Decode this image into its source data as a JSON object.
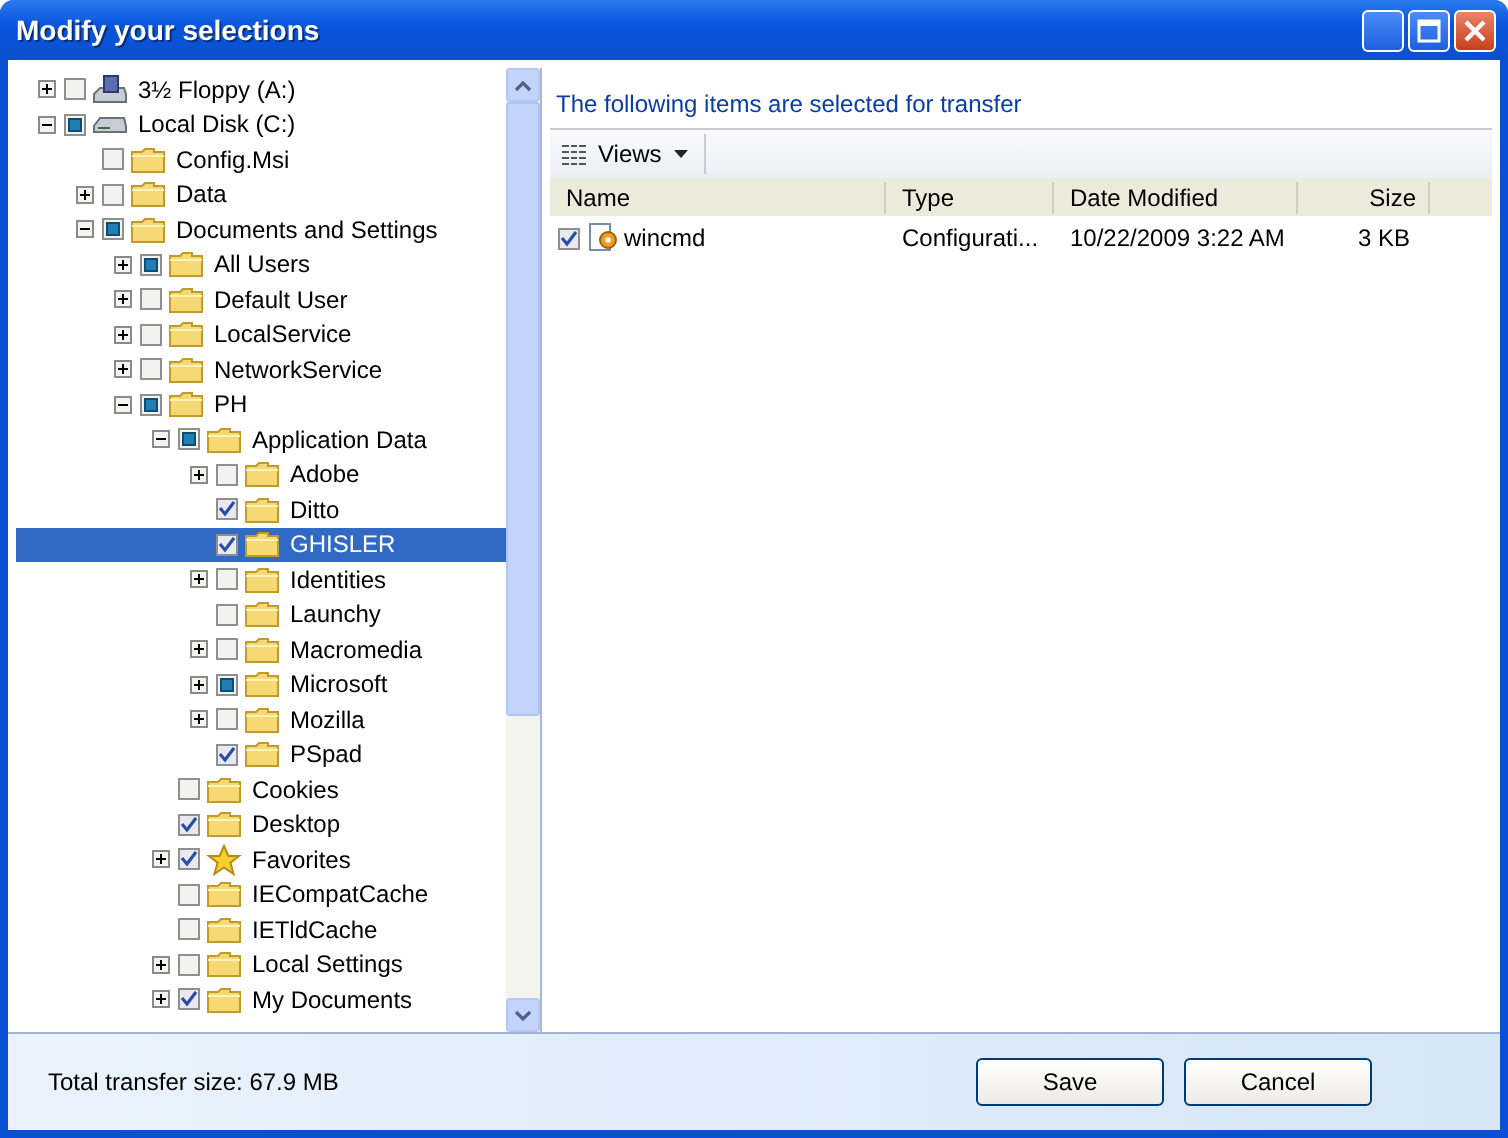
{
  "window": {
    "title": "Modify your selections"
  },
  "tree": [
    {
      "label": "3½ Floppy (A:)",
      "kind": "floppy",
      "checked": false,
      "partial": false,
      "expanded": false,
      "selected": false
    },
    {
      "label": "Local Disk (C:)",
      "kind": "drive",
      "checked": false,
      "partial": true,
      "expanded": true,
      "selected": false,
      "children": [
        {
          "label": "Config.Msi",
          "kind": "folder",
          "checked": false,
          "partial": false,
          "selected": false
        },
        {
          "label": "Data",
          "kind": "folder",
          "checked": false,
          "partial": false,
          "expanded": false,
          "selected": false
        },
        {
          "label": "Documents and Settings",
          "kind": "folder",
          "checked": false,
          "partial": true,
          "expanded": true,
          "selected": false,
          "children": [
            {
              "label": "All Users",
              "kind": "folder",
              "checked": false,
              "partial": true,
              "expanded": false,
              "selected": false
            },
            {
              "label": "Default User",
              "kind": "folder",
              "checked": false,
              "partial": false,
              "expanded": false,
              "selected": false
            },
            {
              "label": "LocalService",
              "kind": "folder",
              "checked": false,
              "partial": false,
              "expanded": false,
              "selected": false
            },
            {
              "label": "NetworkService",
              "kind": "folder",
              "checked": false,
              "partial": false,
              "expanded": false,
              "selected": false
            },
            {
              "label": "PH",
              "kind": "folder",
              "checked": false,
              "partial": true,
              "expanded": true,
              "selected": false,
              "children": [
                {
                  "label": "Application Data",
                  "kind": "folder",
                  "checked": false,
                  "partial": true,
                  "expanded": true,
                  "selected": false,
                  "children": [
                    {
                      "label": "Adobe",
                      "kind": "folder",
                      "checked": false,
                      "partial": false,
                      "expanded": false,
                      "selected": false
                    },
                    {
                      "label": "Ditto",
                      "kind": "folder",
                      "checked": true,
                      "partial": false,
                      "selected": false
                    },
                    {
                      "label": "GHISLER",
                      "kind": "folder",
                      "checked": true,
                      "partial": false,
                      "selected": true
                    },
                    {
                      "label": "Identities",
                      "kind": "folder",
                      "checked": false,
                      "partial": false,
                      "expanded": false,
                      "selected": false
                    },
                    {
                      "label": "Launchy",
                      "kind": "folder",
                      "checked": false,
                      "partial": false,
                      "selected": false
                    },
                    {
                      "label": "Macromedia",
                      "kind": "folder",
                      "checked": false,
                      "partial": false,
                      "expanded": false,
                      "selected": false
                    },
                    {
                      "label": "Microsoft",
                      "kind": "folder",
                      "checked": false,
                      "partial": true,
                      "expanded": false,
                      "selected": false
                    },
                    {
                      "label": "Mozilla",
                      "kind": "folder",
                      "checked": false,
                      "partial": false,
                      "expanded": false,
                      "selected": false
                    },
                    {
                      "label": "PSpad",
                      "kind": "folder",
                      "checked": true,
                      "partial": false,
                      "selected": false
                    }
                  ]
                },
                {
                  "label": "Cookies",
                  "kind": "folder",
                  "checked": false,
                  "partial": false,
                  "selected": false
                },
                {
                  "label": "Desktop",
                  "kind": "folder",
                  "checked": true,
                  "partial": false,
                  "selected": false
                },
                {
                  "label": "Favorites",
                  "kind": "star",
                  "checked": true,
                  "partial": false,
                  "expanded": false,
                  "selected": false
                },
                {
                  "label": "IECompatCache",
                  "kind": "folder",
                  "checked": false,
                  "partial": false,
                  "selected": false
                },
                {
                  "label": "IETldCache",
                  "kind": "folder",
                  "checked": false,
                  "partial": false,
                  "selected": false
                },
                {
                  "label": "Local Settings",
                  "kind": "folder",
                  "checked": false,
                  "partial": false,
                  "expanded": false,
                  "selected": false
                },
                {
                  "label": "My Documents",
                  "kind": "folder",
                  "checked": true,
                  "partial": false,
                  "expanded": false,
                  "selected": false
                }
              ]
            }
          ]
        }
      ]
    }
  ],
  "details": {
    "heading": "The following items are selected for transfer",
    "views_button": "Views",
    "columns": [
      "Name",
      "Type",
      "Date Modified",
      "Size"
    ],
    "rows": [
      {
        "checked": true,
        "name": "wincmd",
        "type": "Configurati...",
        "date": "10/22/2009 3:22 AM",
        "size": "3 KB"
      }
    ]
  },
  "status": "Total transfer size: 67.9 MB",
  "buttons": [
    "Save",
    "Cancel"
  ]
}
